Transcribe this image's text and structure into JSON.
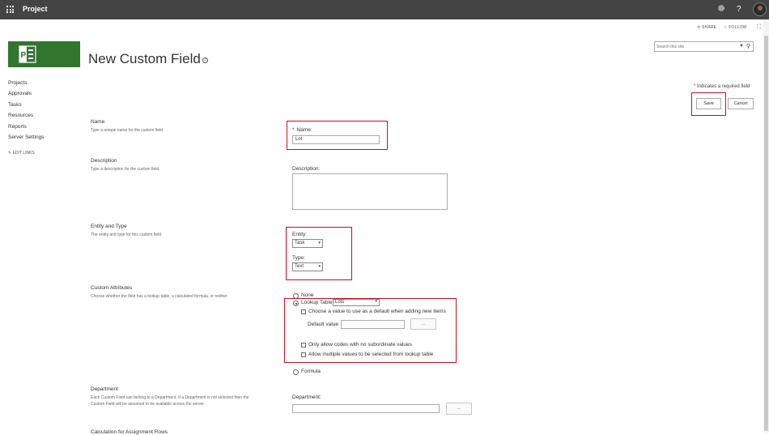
{
  "topbar": {
    "app_name": "Project",
    "settings_icon": "gear-icon",
    "help_label": "?",
    "avatar": "user-avatar"
  },
  "share_bar": {
    "share_label": "SHARE",
    "follow_label": "FOLLOW"
  },
  "page": {
    "title": "New Custom Field"
  },
  "search": {
    "placeholder": "Search this site"
  },
  "nav": {
    "items": [
      "Projects",
      "Approvals",
      "Tasks",
      "Resources",
      "Reports",
      "Server Settings"
    ],
    "edit_links": "EDIT LINKS"
  },
  "required_note": {
    "star": "*",
    "text": "Indicates a required field"
  },
  "buttons": {
    "save": "Save",
    "cancel": "Cancel"
  },
  "sections": {
    "name": {
      "title": "Name",
      "desc": "Type a unique name for the custom field.",
      "label": "Name:",
      "star": "*",
      "value": "Lot"
    },
    "description": {
      "title": "Description",
      "desc": "Type a description for the custom field.",
      "label": "Description:"
    },
    "entity_type": {
      "title": "Entity and Type",
      "desc": "The entity and type for this custom field.",
      "entity_label": "Entity:",
      "entity_value": "Task",
      "type_label": "Type:",
      "type_value": "Text"
    },
    "custom_attributes": {
      "title": "Custom Attributes",
      "desc": "Choose whether the field has a lookup table, a calculated formula, or neither.",
      "none_label": "None",
      "lookup_label": "Lookup Table",
      "lookup_value": "Lots",
      "default_check_label": "Choose a value to use as a default when adding new items",
      "default_value_label": "Default value",
      "ellipsis": "...",
      "only_codes_label": "Only allow codes with no subordinate values",
      "multiple_label": "Allow multiple values to be selected from lookup table",
      "formula_label": "Formula"
    },
    "department": {
      "title": "Department",
      "desc_line1": "Each Custom Field can belong to a Department. If a Department is not selected then the",
      "desc_line2": "Custom Field will be assumed to be available across the server.",
      "label": "Department:",
      "ellipsis": "..."
    },
    "next": {
      "title": "Calculation for Assignment Rows"
    }
  }
}
